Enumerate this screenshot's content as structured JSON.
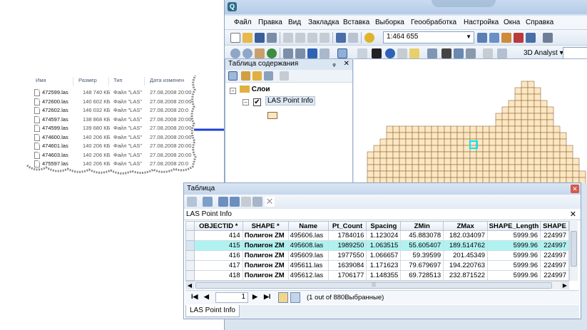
{
  "explorer": {
    "columns": [
      "Имя",
      "Размер",
      "Тип",
      "Дата изменен"
    ],
    "files": [
      {
        "name": "472599.las",
        "size": "148 740 КБ",
        "type": "Файл \"LAS\"",
        "date": "27.08.2008 20:00"
      },
      {
        "name": "472600.las",
        "size": "140 602 КБ",
        "type": "Файл \"LAS\"",
        "date": "27.08.2008 20:00"
      },
      {
        "name": "472602.las",
        "size": "146 032 КБ",
        "type": "Файл \"LAS\"",
        "date": "27.08.2008 20:0"
      },
      {
        "name": "474597.las",
        "size": "138 868 КБ",
        "type": "Файл \"LAS\"",
        "date": "27.08.2008 20:00"
      },
      {
        "name": "474599.las",
        "size": "139 680 КБ",
        "type": "Файл \"LAS\"",
        "date": "27.08.2008 20:00"
      },
      {
        "name": "474600.las",
        "size": "140 206 КБ",
        "type": "Файл \"LAS\"",
        "date": "27.08.2008 20:00"
      },
      {
        "name": "474601.las",
        "size": "140 206 КБ",
        "type": "Файл \"LAS\"",
        "date": "27.08.2008 20:00"
      },
      {
        "name": "474603.las",
        "size": "140 206 КБ",
        "type": "Файл \"LAS\"",
        "date": "27.08.2008 20:00"
      },
      {
        "name": "475597.las",
        "size": "140 206 КБ",
        "type": "Файл \"LAS\"",
        "date": "27.08.2008 20:0"
      }
    ]
  },
  "arcmap": {
    "app_icon": "Q",
    "menu": [
      "Файл",
      "Правка",
      "Вид",
      "Закладка",
      "Вставка",
      "Выборка",
      "Геообработка",
      "Настройка",
      "Окна",
      "Справка"
    ],
    "scale": "1:464 655",
    "extension_menu": "3D Analyst ▾",
    "toc": {
      "title": "Таблица содержания",
      "pin": "ᵩ",
      "close": "✕",
      "group": "Слои",
      "layer": "LAS Point Info"
    }
  },
  "table_window": {
    "title": "Таблица",
    "close": "✕",
    "subtitle": "LAS Point Info",
    "columns": [
      "",
      "OBJECTID *",
      "SHAPE *",
      "Name",
      "Pt_Count",
      "Spacing",
      "ZMin",
      "ZMax",
      "SHAPE_Length",
      "SHAPE"
    ],
    "rows": [
      {
        "objectid": "414",
        "shape": "Полигон ZM",
        "name": "495606.las",
        "pt_count": "1784016",
        "spacing": "1.123024",
        "zmin": "45.883078",
        "zmax": "182.034097",
        "shape_length": "5999.96",
        "shape_area": "224997",
        "highlight": false
      },
      {
        "objectid": "415",
        "shape": "Полигон ZM",
        "name": "495608.las",
        "pt_count": "1989250",
        "spacing": "1.063515",
        "zmin": "55.605407",
        "zmax": "189.514762",
        "shape_length": "5999.96",
        "shape_area": "224997",
        "highlight": true
      },
      {
        "objectid": "416",
        "shape": "Полигон ZM",
        "name": "495609.las",
        "pt_count": "1977550",
        "spacing": "1.066657",
        "zmin": "59.39599",
        "zmax": "201.45349",
        "shape_length": "5999.96",
        "shape_area": "224997",
        "highlight": false
      },
      {
        "objectid": "417",
        "shape": "Полигон ZM",
        "name": "495611.las",
        "pt_count": "1639084",
        "spacing": "1.171623",
        "zmin": "79.679697",
        "zmax": "194.220763",
        "shape_length": "5999.96",
        "shape_area": "224997",
        "highlight": false
      },
      {
        "objectid": "418",
        "shape": "Полигон ZM",
        "name": "495612.las",
        "pt_count": "1706177",
        "spacing": "1.148355",
        "zmin": "69.728513",
        "zmax": "232.871522",
        "shape_length": "5999.96",
        "shape_area": "224997",
        "highlight": false
      }
    ],
    "nav": {
      "first": "I◀",
      "prev": "◀",
      "record": "1",
      "next": "▶",
      "last": "▶I",
      "status": "(1 out of 880Выбранные)"
    },
    "tab": "LAS Point Info"
  },
  "colors": {
    "tile_fill": "#fde7c2",
    "tile_stroke": "#8b6b3e",
    "selection": "#00e5ff",
    "row_highlight": "#aef3f0",
    "arrow": "#1f3fd6"
  }
}
